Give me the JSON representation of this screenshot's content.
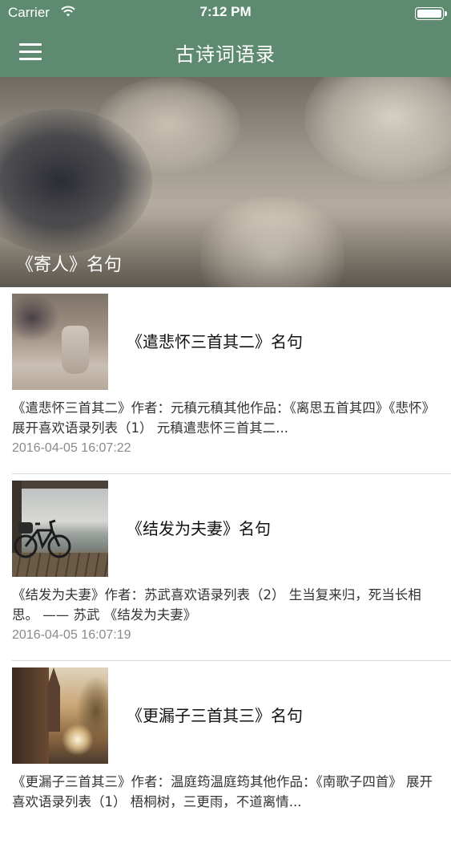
{
  "status_bar": {
    "carrier": "Carrier",
    "time": "7:12 PM"
  },
  "nav": {
    "title": "古诗词语录",
    "menu_icon": "hamburger-menu-icon"
  },
  "colors": {
    "nav_background": "#5e8a72",
    "date_text": "#8a8a8a"
  },
  "banner": {
    "caption": "《寄人》名句"
  },
  "items": [
    {
      "headline": "《遣悲怀三首其二》名句",
      "excerpt": "《遣悲怀三首其二》作者：元稹元稹其他作品：《离思五首其四》《悲怀》 展开喜欢语录列表（1） 元稹遣悲怀三首其二...",
      "date": "2016-04-05 16:07:22"
    },
    {
      "headline": "《结发为夫妻》名句",
      "excerpt": "《结发为夫妻》作者：苏武喜欢语录列表（2） 生当复来归，死当长相思。 —— 苏武 《结发为夫妻》",
      "date": "2016-04-05 16:07:19"
    },
    {
      "headline": "《更漏子三首其三》名句",
      "excerpt": "《更漏子三首其三》作者：温庭筠温庭筠其他作品：《南歌子四首》 展开喜欢语录列表（1） 梧桐树，三更雨，不道离情...",
      "date": ""
    }
  ]
}
